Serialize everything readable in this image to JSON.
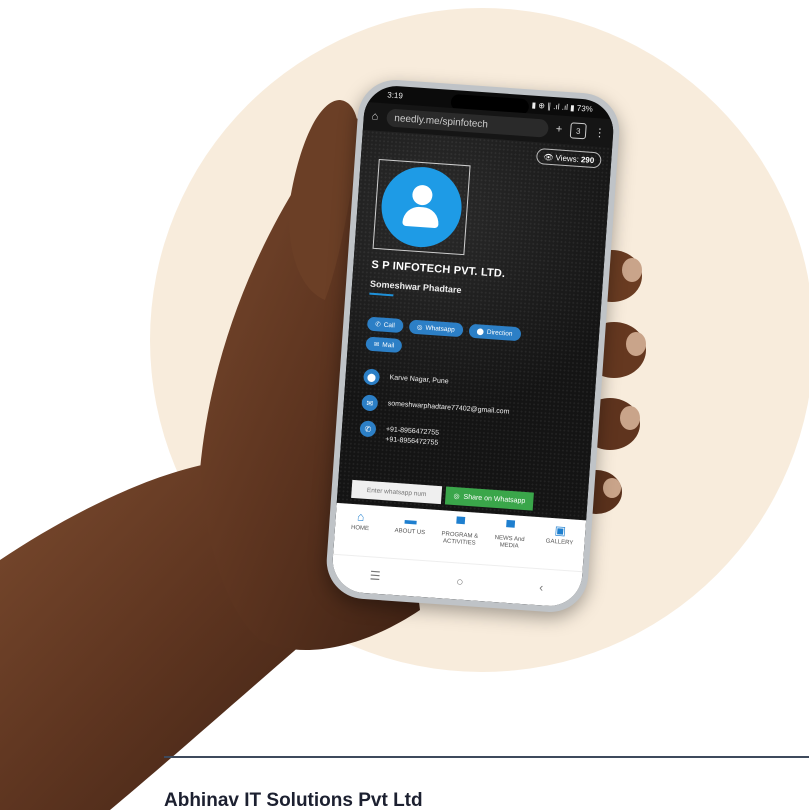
{
  "status_bar": {
    "time": "3:19",
    "indicators": "▮ ⊕ ∥ .ıl .ıl ▮ 73%"
  },
  "browser": {
    "url": "needly.me/spinfotech",
    "tab_count": "3"
  },
  "profile": {
    "views_label": "Views:",
    "views_count": "290",
    "company": "S P INFOTECH PVT. LTD.",
    "person": "Someshwar Phadtare"
  },
  "actions": {
    "call": "Call",
    "whatsapp": "Whatsapp",
    "direction": "Direction",
    "mail": "Mail"
  },
  "contact": {
    "address": "Karve Nagar, Pune",
    "email": "someshwarphadtare77402@gmail.com",
    "phone1": "+91-8956472755",
    "phone2": "+91-8956472755"
  },
  "share": {
    "input_placeholder": "Enter whatsapp num",
    "button": "Share on Whatsapp"
  },
  "bottom_nav": [
    {
      "label": "HOME",
      "icon": "home-icon"
    },
    {
      "label": "ABOUT US",
      "icon": "briefcase-icon"
    },
    {
      "label": "PROGRAM & ACTIVITIES",
      "icon": "boxes-icon"
    },
    {
      "label": "NEWS And MEDIA",
      "icon": "boxes-icon"
    },
    {
      "label": "GALLERY",
      "icon": "image-file-icon"
    }
  ],
  "footer": {
    "title": "Abhinav IT Solutions Pvt Ltd"
  },
  "colors": {
    "accent": "#1e7fcf",
    "background_circle": "#f8ecdc",
    "whatsapp_green": "#3aa64a"
  }
}
